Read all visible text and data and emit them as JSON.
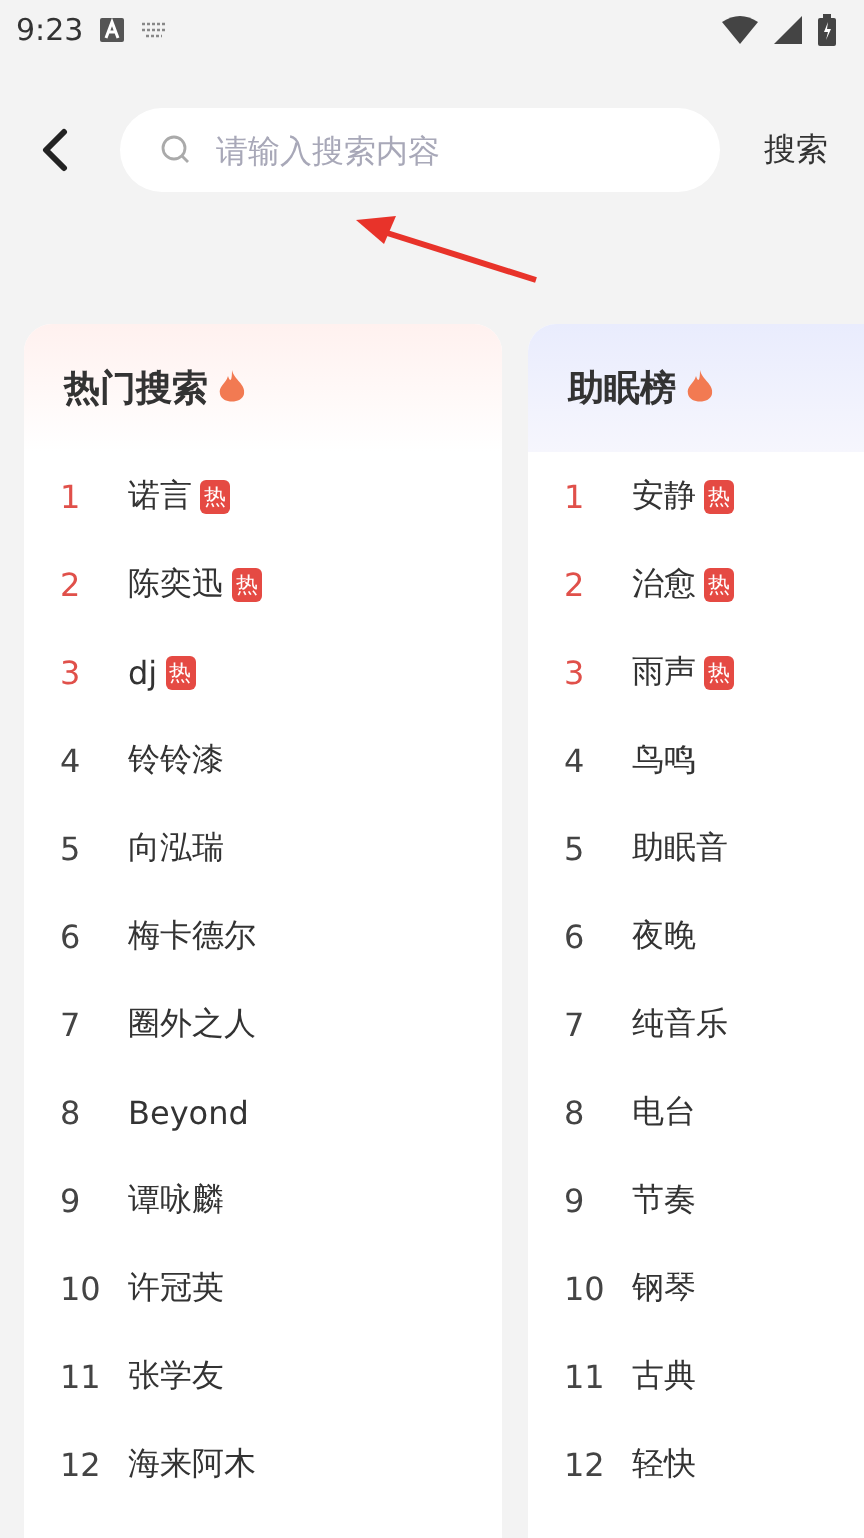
{
  "status_bar": {
    "time": "9:23"
  },
  "search": {
    "placeholder": "请输入搜索内容",
    "button": "搜索"
  },
  "boards": [
    {
      "title": "热门搜索",
      "kind": "warm",
      "items": [
        {
          "rank": "1",
          "name": "诺言",
          "top": true,
          "badge": "热"
        },
        {
          "rank": "2",
          "name": "陈奕迅",
          "top": true,
          "badge": "热"
        },
        {
          "rank": "3",
          "name": "dj",
          "top": true,
          "badge": "热"
        },
        {
          "rank": "4",
          "name": "铃铃漆",
          "top": false
        },
        {
          "rank": "5",
          "name": "向泓瑞",
          "top": false
        },
        {
          "rank": "6",
          "name": "梅卡德尔",
          "top": false
        },
        {
          "rank": "7",
          "name": "圈外之人",
          "top": false
        },
        {
          "rank": "8",
          "name": "Beyond",
          "top": false
        },
        {
          "rank": "9",
          "name": "谭咏麟",
          "top": false
        },
        {
          "rank": "10",
          "name": "许冠英",
          "top": false
        },
        {
          "rank": "11",
          "name": "张学友",
          "top": false
        },
        {
          "rank": "12",
          "name": "海来阿木",
          "top": false
        }
      ]
    },
    {
      "title": "助眠榜",
      "kind": "cool",
      "items": [
        {
          "rank": "1",
          "name": "安静",
          "top": true,
          "badge": "热"
        },
        {
          "rank": "2",
          "name": "治愈",
          "top": true,
          "badge": "热"
        },
        {
          "rank": "3",
          "name": "雨声",
          "top": true,
          "badge": "热"
        },
        {
          "rank": "4",
          "name": "鸟鸣",
          "top": false
        },
        {
          "rank": "5",
          "name": "助眠音",
          "top": false
        },
        {
          "rank": "6",
          "name": "夜晚",
          "top": false
        },
        {
          "rank": "7",
          "name": "纯音乐",
          "top": false
        },
        {
          "rank": "8",
          "name": "电台",
          "top": false
        },
        {
          "rank": "9",
          "name": "节奏",
          "top": false
        },
        {
          "rank": "10",
          "name": "钢琴",
          "top": false
        },
        {
          "rank": "11",
          "name": "古典",
          "top": false
        },
        {
          "rank": "12",
          "name": "轻快",
          "top": false
        }
      ]
    }
  ]
}
